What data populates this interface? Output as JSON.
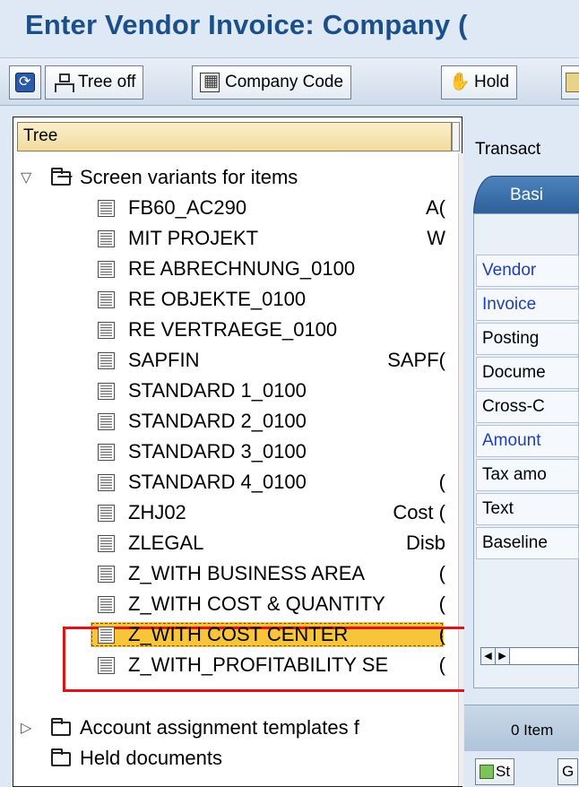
{
  "window": {
    "title": "Enter Vendor Invoice: Company ("
  },
  "toolbar": {
    "refresh_icon": "refresh-icon",
    "tree_off_label": "Tree off",
    "company_code_label": "Company Code",
    "hold_label": "Hold"
  },
  "tree": {
    "header": "Tree",
    "root_folder": {
      "expander": "▽",
      "label": "Screen variants for items",
      "items": [
        {
          "name": "FB60_AC290",
          "desc": "A("
        },
        {
          "name": "MIT PROJEKT",
          "desc": "W"
        },
        {
          "name": "RE ABRECHNUNG_0100",
          "desc": ""
        },
        {
          "name": "RE OBJEKTE_0100",
          "desc": ""
        },
        {
          "name": "RE VERTRAEGE_0100",
          "desc": ""
        },
        {
          "name": "SAPFIN",
          "desc": "SAPF("
        },
        {
          "name": "STANDARD 1_0100",
          "desc": ""
        },
        {
          "name": "STANDARD 2_0100",
          "desc": ""
        },
        {
          "name": "STANDARD 3_0100",
          "desc": ""
        },
        {
          "name": "STANDARD 4_0100",
          "desc": "("
        },
        {
          "name": "ZHJ02",
          "desc": "Cost ("
        },
        {
          "name": "ZLEGAL",
          "desc": "Disb"
        },
        {
          "name": "Z_WITH BUSINESS AREA",
          "desc": "("
        },
        {
          "name": "Z_WITH COST & QUANTITY",
          "desc": "("
        },
        {
          "name": "Z_WITH COST CENTER",
          "desc": "("
        },
        {
          "name": "Z_WITH_PROFITABILITY SE",
          "desc": "("
        }
      ]
    },
    "other_folders": [
      {
        "expander": "▷",
        "label": "Account assignment templates f"
      },
      {
        "expander": "",
        "label": "Held documents"
      }
    ]
  },
  "detail": {
    "transaction_label": "Transact",
    "tab_basic": "Basi",
    "fields": [
      {
        "label": "Vendor",
        "required": true
      },
      {
        "label": "Invoice",
        "required": true
      },
      {
        "label": "Posting",
        "required": false
      },
      {
        "label": "Docume",
        "required": false
      },
      {
        "label": "Cross-C",
        "required": false
      },
      {
        "label": "Amount",
        "required": true
      },
      {
        "label": "Tax amo",
        "required": false
      },
      {
        "label": "Text",
        "required": false
      },
      {
        "label": "Baseline",
        "required": false
      }
    ],
    "items_label": "0 Item",
    "bottom_buttons": {
      "st_label": "St",
      "g_label": "G"
    }
  },
  "colors": {
    "title": "#1a4f8a",
    "selection": "#f8c53a",
    "highlight_box": "#e0121a",
    "required_field_text": "#1f3fb8"
  }
}
